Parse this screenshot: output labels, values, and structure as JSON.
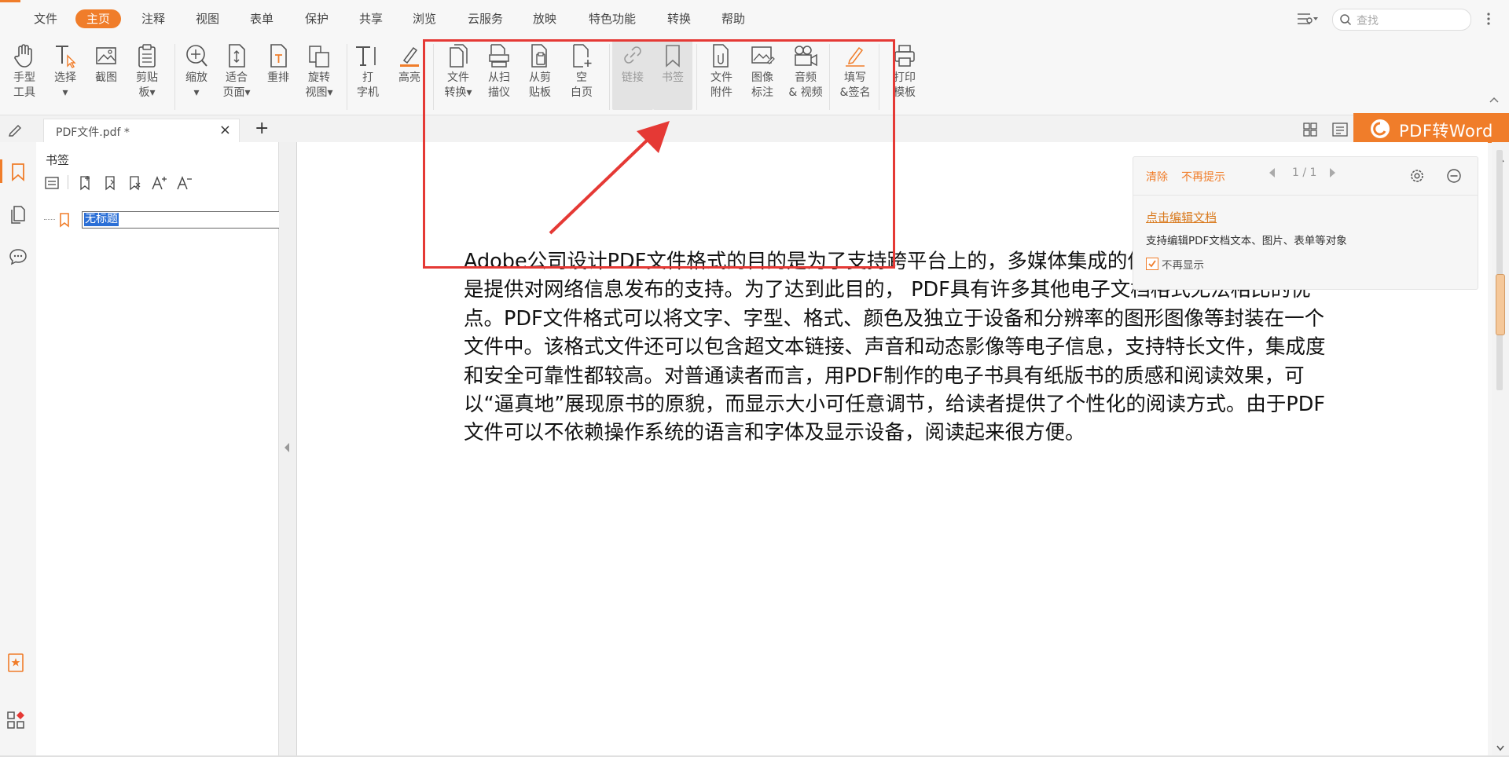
{
  "menu": {
    "items": [
      "文件",
      "主页",
      "注释",
      "视图",
      "表单",
      "保护",
      "共享",
      "浏览",
      "云服务",
      "放映",
      "特色功能",
      "转换",
      "帮助"
    ],
    "active": "主页"
  },
  "search": {
    "placeholder": "查找"
  },
  "ribbon": {
    "tools": [
      {
        "label": "手型\n工具",
        "icon": "hand-icon"
      },
      {
        "label": "选择\n▾",
        "icon": "select-text-icon"
      },
      {
        "label": "截图",
        "icon": "screenshot-icon"
      },
      {
        "label": "剪贴\n板▾",
        "icon": "clipboard-icon"
      },
      {
        "label": "缩放\n▾",
        "icon": "zoom-icon"
      },
      {
        "label": "适合\n页面▾",
        "icon": "fit-page-icon"
      },
      {
        "label": "重排",
        "icon": "reflow-icon"
      },
      {
        "label": "旋转\n视图▾",
        "icon": "rotate-view-icon"
      },
      {
        "label": "打\n字机",
        "icon": "typewriter-icon"
      },
      {
        "label": "高亮",
        "icon": "highlight-icon"
      },
      {
        "label": "文件\n转换▾",
        "icon": "file-convert-icon"
      },
      {
        "label": "从扫\n描仪",
        "icon": "scanner-icon"
      },
      {
        "label": "从剪\n贴板",
        "icon": "from-clipboard-icon"
      },
      {
        "label": "空\n白页",
        "icon": "blank-page-icon"
      },
      {
        "label": "链接",
        "icon": "link-icon"
      },
      {
        "label": "书签",
        "icon": "bookmark-icon"
      },
      {
        "label": "文件\n附件",
        "icon": "attachment-icon"
      },
      {
        "label": "图像\n标注",
        "icon": "image-annotation-icon"
      },
      {
        "label": "音频\n& 视频",
        "icon": "audio-video-icon"
      },
      {
        "label": "填写\n&签名",
        "icon": "fill-sign-icon"
      },
      {
        "label": "打印\n模板",
        "icon": "print-template-icon"
      }
    ]
  },
  "tab": {
    "title": "PDF文件.pdf *",
    "close": "×",
    "add": "+"
  },
  "promo": {
    "label": "PDF转Word"
  },
  "bookmarks": {
    "title": "书签",
    "item": "无标题"
  },
  "popup": {
    "clear": "清除",
    "no_more_tips": "不再提示",
    "page_indicator": "1 / 1",
    "link": "点击编辑文档",
    "description": "支持编辑PDF文档文本、图片、表单等对象",
    "checkbox_label": "不再显示"
  },
  "document": {
    "paragraph": "Adobe公司设计PDF文件格式的目的是为了支持跨平台上的，多媒体集成的信息出版和发布，尤其是提供对网络信息发布的支持。为了达到此目的， PDF具有许多其他电子文档格式无法相比的优点。PDF文件格式可以将文字、字型、格式、颜色及独立于设备和分辨率的图形图像等封装在一个文件中。该格式文件还可以包含超文本链接、声音和动态影像等电子信息，支持特长文件，集成度和安全可靠性都较高。对普通读者而言，用PDF制作的电子书具有纸版书的质感和阅读效果，可以“逼真地”展现原书的原貌，而显示大小可任意调节，给读者提供了个性化的阅读方式。由于PDF文件可以不依赖操作系统的语言和字体及显示设备，阅读起来很方便。"
  },
  "colors": {
    "accent": "#f07d2a",
    "annotation_red": "#e53935",
    "selection_blue": "#2b6fd6"
  }
}
